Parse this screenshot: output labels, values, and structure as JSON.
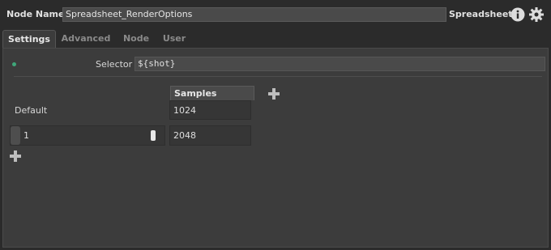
{
  "header": {
    "node_name_label": "Node Name",
    "node_name_value": "Spreadsheet_RenderOptions",
    "node_type": "Spreadsheet"
  },
  "tabs": [
    {
      "label": "Settings",
      "active": true
    },
    {
      "label": "Advanced",
      "active": false
    },
    {
      "label": "Node",
      "active": false
    },
    {
      "label": "User",
      "active": false
    }
  ],
  "settings": {
    "selector_label": "Selector",
    "selector_value": "${shot}",
    "column_header": "Samples",
    "default_row_label": "Default",
    "default_value": "1024",
    "rows": [
      {
        "name": "1",
        "value": "2048"
      }
    ]
  },
  "colors": {
    "status_dot": "#3fa77a",
    "panel_bg": "#3c3c3c"
  }
}
